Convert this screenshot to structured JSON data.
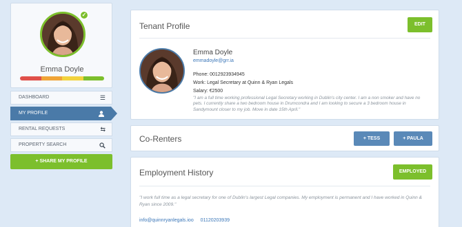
{
  "sidebar": {
    "profile": {
      "name": "Emma Doyle",
      "avatar_icon": "avatar-photo",
      "verified_icon": "checkmark-icon",
      "completeness_colors": [
        "#e0504a",
        "#f0a437",
        "#f2d33d",
        "#7cbf2c"
      ]
    },
    "nav": [
      {
        "label": "DASHBOARD",
        "icon": "menu-icon",
        "glyph": "☰"
      },
      {
        "label": "MY PROFILE",
        "icon": "user-icon",
        "glyph": "👤"
      },
      {
        "label": "RENTAL REQUESTS",
        "icon": "sliders-icon",
        "glyph": "⇆"
      },
      {
        "label": "PROPERTY SEARCH",
        "icon": "search-icon",
        "glyph": "⌕"
      }
    ],
    "share_label": "+ SHARE MY PROFILE"
  },
  "tenant_profile": {
    "title": "Tenant Profile",
    "edit_label": "EDIT",
    "name": "Emma Doyle",
    "email": "emmadoyle@grr.ia",
    "phone": "Phone: 0012923934945",
    "work": "Work: Legal Secretary at Quinn & Ryan Legals",
    "salary": "Salary: €2500",
    "bio": "\"I am a full time working professional Legal Secretary working in Dublin's city center. I am a non smoker and have no pets. I currently share a two bedroom house in Drumcondra and I am looking to secure a 3 bedroom house in Sandymount closer to my job. Move in date 15th April.\""
  },
  "co_renters": {
    "title": "Co-Renters",
    "buttons": [
      "+ TESS",
      "+ PAULA"
    ]
  },
  "employment": {
    "title": "Employment History",
    "status_label": "EMPLOYED",
    "quote": "\"I work full time as a legal secretary for one of Dublin's largest Legal companies. My employment is permanent and I have worked in Quinn & Ryan since 2009.\"",
    "email": "info@quinnryanlegals.ioo",
    "phone": "01120203939"
  },
  "colors": {
    "accent_green": "#7cbf2c",
    "accent_blue": "#4a7aa8",
    "background": "#dde9f6"
  }
}
